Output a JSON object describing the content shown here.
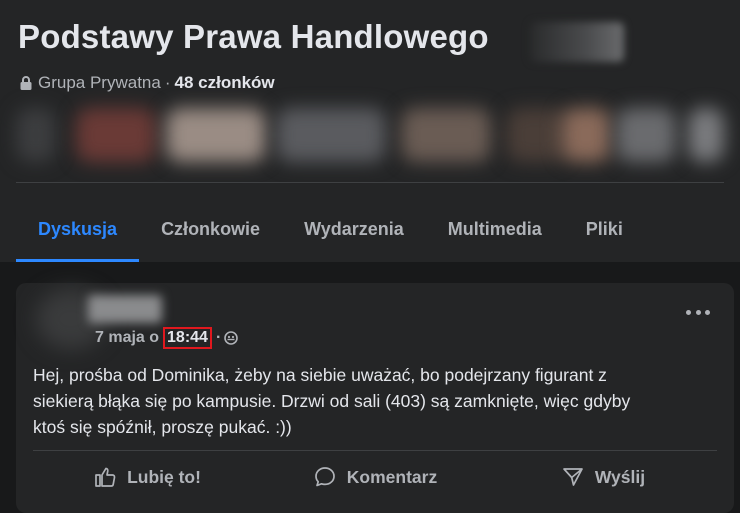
{
  "group": {
    "title": "Podstawy Prawa Handlowego",
    "privacy": "Grupa Prywatna",
    "separator": "·",
    "members": "48 członków"
  },
  "tabs": [
    {
      "label": "Dyskusja",
      "active": true
    },
    {
      "label": "Członkowie",
      "active": false
    },
    {
      "label": "Wydarzenia",
      "active": false
    },
    {
      "label": "Multimedia",
      "active": false
    },
    {
      "label": "Pliki",
      "active": false
    }
  ],
  "post": {
    "date": "7 maja o",
    "time": "18:44",
    "dot": "·",
    "text_lines": [
      "Hej, prośba od Dominika, żeby na siebie uważać, bo podejrzany figurant z",
      "siekierą  błąka się po kampusie. Drzwi od sali (403) są zamknięte, więc gdyby",
      "ktoś się spóźnił, proszę pukać. :))"
    ],
    "actions": {
      "like": "Lubię to!",
      "comment": "Komentarz",
      "share": "Wyślij"
    }
  },
  "colors": {
    "background": "#18191a",
    "surface": "#242526",
    "accent": "#2d88ff",
    "highlight_box": "#e0181e",
    "text_primary": "#e4e6eb",
    "text_secondary": "#b0b3b8"
  },
  "icons": {
    "privacy": "lock-icon",
    "audience": "globe-icon",
    "more": "more-icon",
    "like": "thumbs-up-icon",
    "comment": "comment-bubble-icon",
    "share": "send-icon"
  }
}
